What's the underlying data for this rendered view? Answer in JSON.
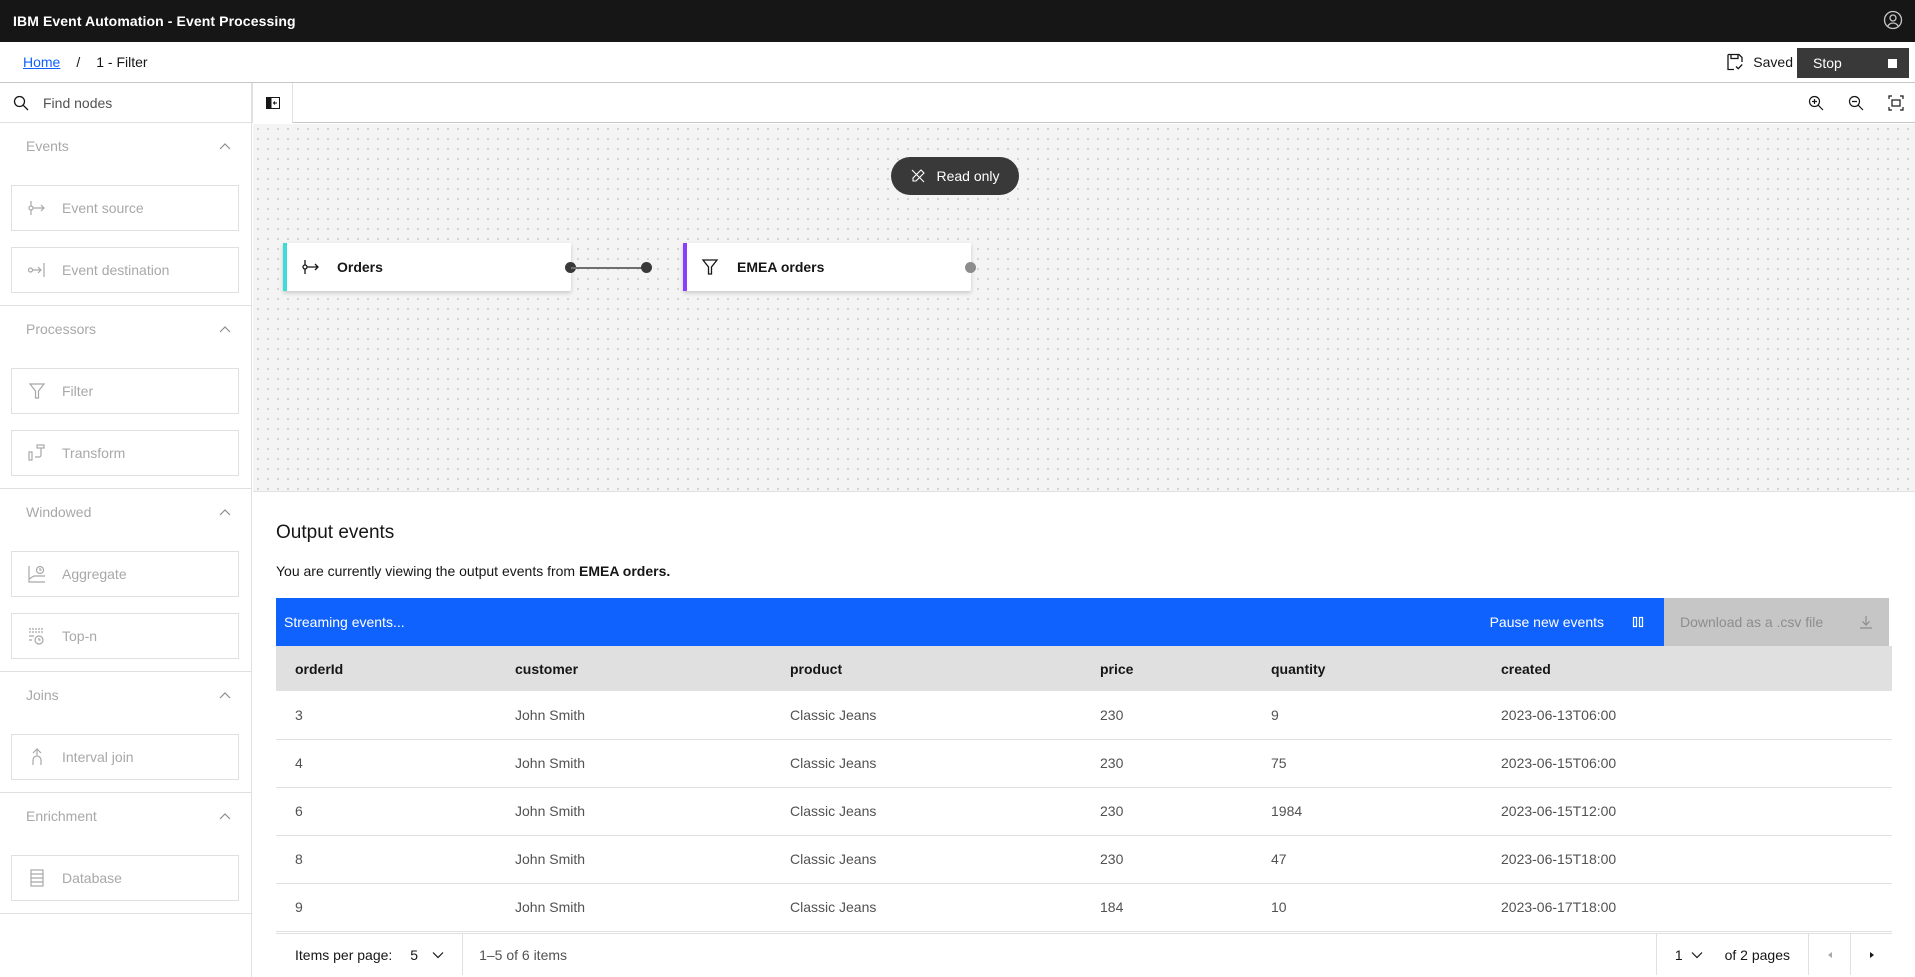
{
  "app": {
    "title": "IBM Event Automation - Event Processing",
    "user_icon": "user-avatar-icon"
  },
  "breadcrumb": {
    "home": "Home",
    "separator": "/",
    "current": "1 - Filter"
  },
  "status": {
    "saved_label": "Saved",
    "stop_label": "Stop"
  },
  "sidebar": {
    "search_placeholder": "Find nodes",
    "sections": [
      {
        "title": "Events",
        "items": [
          {
            "label": "Event source",
            "icon": "event-source-icon"
          },
          {
            "label": "Event destination",
            "icon": "event-destination-icon"
          }
        ]
      },
      {
        "title": "Processors",
        "items": [
          {
            "label": "Filter",
            "icon": "filter-icon"
          },
          {
            "label": "Transform",
            "icon": "transform-icon"
          }
        ]
      },
      {
        "title": "Windowed",
        "items": [
          {
            "label": "Aggregate",
            "icon": "aggregate-icon"
          },
          {
            "label": "Top-n",
            "icon": "top-n-icon"
          }
        ]
      },
      {
        "title": "Joins",
        "items": [
          {
            "label": "Interval join",
            "icon": "interval-join-icon"
          }
        ]
      },
      {
        "title": "Enrichment",
        "items": [
          {
            "label": "Database",
            "icon": "database-icon"
          }
        ]
      }
    ]
  },
  "canvas": {
    "readonly_label": "Read only",
    "nodes": [
      {
        "label": "Orders",
        "type": "event-source",
        "accent": "#3ddbd9"
      },
      {
        "label": "EMEA orders",
        "type": "filter",
        "accent": "#8a3ffc"
      }
    ]
  },
  "output": {
    "title": "Output events",
    "desc_prefix": "You are currently viewing the output events from ",
    "desc_node": "EMEA orders",
    "desc_suffix": ".",
    "streaming_label": "Streaming events...",
    "pause_label": "Pause new events",
    "download_label": "Download as a .csv file",
    "accent": "#0f62fe",
    "columns": [
      "orderId",
      "customer",
      "product",
      "price",
      "quantity",
      "created"
    ],
    "rows": [
      [
        "3",
        "John Smith",
        "Classic Jeans",
        "230",
        "9",
        "2023-06-13T06:00"
      ],
      [
        "4",
        "John Smith",
        "Classic Jeans",
        "230",
        "75",
        "2023-06-15T06:00"
      ],
      [
        "6",
        "John Smith",
        "Classic Jeans",
        "230",
        "1984",
        "2023-06-15T12:00"
      ],
      [
        "8",
        "John Smith",
        "Classic Jeans",
        "230",
        "47",
        "2023-06-15T18:00"
      ],
      [
        "9",
        "John Smith",
        "Classic Jeans",
        "184",
        "10",
        "2023-06-17T18:00"
      ]
    ]
  },
  "pagination": {
    "items_per_page_label": "Items per page:",
    "items_per_page": "5",
    "range_text": "1–5 of 6 items",
    "current_page": "1",
    "total_pages_text": "of 2 pages"
  }
}
